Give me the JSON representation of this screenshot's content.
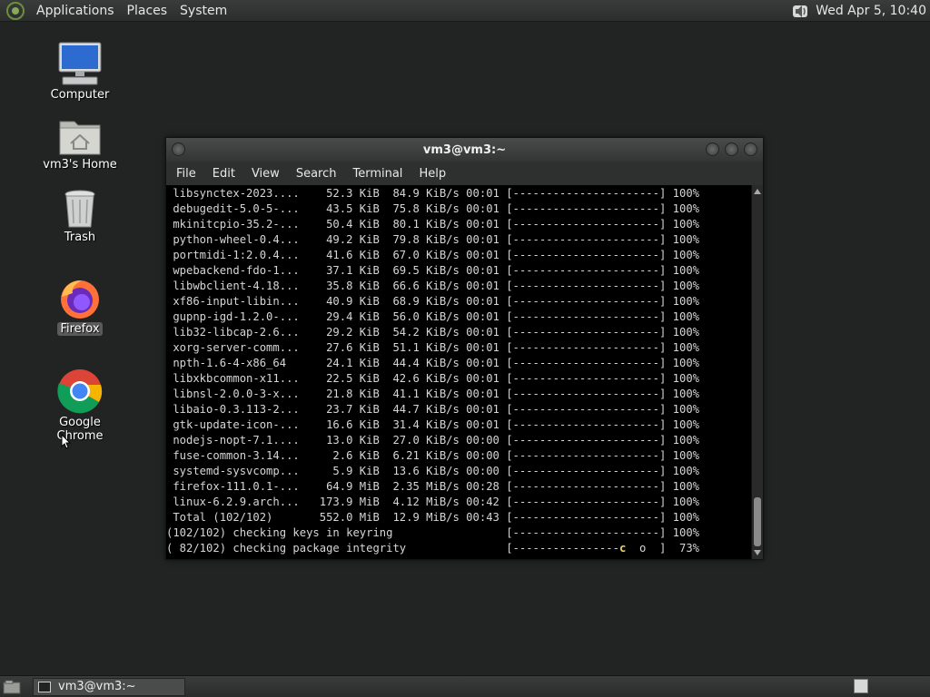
{
  "top_panel": {
    "menus": [
      "Applications",
      "Places",
      "System"
    ],
    "clock": "Wed Apr  5, 10:40"
  },
  "desktop_icons": [
    {
      "label": "Computer",
      "icon": "computer-icon"
    },
    {
      "label": "vm3's Home",
      "icon": "home-folder-icon"
    },
    {
      "label": "Trash",
      "icon": "trash-icon"
    },
    {
      "label": "Firefox",
      "icon": "firefox-icon"
    },
    {
      "label": "Google Chrome",
      "icon": "chrome-icon"
    }
  ],
  "window": {
    "title": "vm3@vm3:~",
    "menu": [
      "File",
      "Edit",
      "View",
      "Search",
      "Terminal",
      "Help"
    ],
    "lines": [
      " libsynctex-2023....    52.3 KiB  84.9 KiB/s 00:01 [----------------------] 100%",
      " debugedit-5.0-5-...    43.5 KiB  75.8 KiB/s 00:01 [----------------------] 100%",
      " mkinitcpio-35.2-...    50.4 KiB  80.1 KiB/s 00:01 [----------------------] 100%",
      " python-wheel-0.4...    49.2 KiB  79.8 KiB/s 00:01 [----------------------] 100%",
      " portmidi-1:2.0.4...    41.6 KiB  67.0 KiB/s 00:01 [----------------------] 100%",
      " wpebackend-fdo-1...    37.1 KiB  69.5 KiB/s 00:01 [----------------------] 100%",
      " libwbclient-4.18...    35.8 KiB  66.6 KiB/s 00:01 [----------------------] 100%",
      " xf86-input-libin...    40.9 KiB  68.9 KiB/s 00:01 [----------------------] 100%",
      " gupnp-igd-1.2.0-...    29.4 KiB  56.0 KiB/s 00:01 [----------------------] 100%",
      " lib32-libcap-2.6...    29.2 KiB  54.2 KiB/s 00:01 [----------------------] 100%",
      " xorg-server-comm...    27.6 KiB  51.1 KiB/s 00:01 [----------------------] 100%",
      " npth-1.6-4-x86_64      24.1 KiB  44.4 KiB/s 00:01 [----------------------] 100%",
      " libxkbcommon-x11...    22.5 KiB  42.6 KiB/s 00:01 [----------------------] 100%",
      " libnsl-2.0.0-3-x...    21.8 KiB  41.1 KiB/s 00:01 [----------------------] 100%",
      " libaio-0.3.113-2...    23.7 KiB  44.7 KiB/s 00:01 [----------------------] 100%",
      " gtk-update-icon-...    16.6 KiB  31.4 KiB/s 00:01 [----------------------] 100%",
      " nodejs-nopt-7.1....    13.0 KiB  27.0 KiB/s 00:00 [----------------------] 100%",
      " fuse-common-3.14...     2.6 KiB  6.21 KiB/s 00:00 [----------------------] 100%",
      " systemd-sysvcomp...     5.9 KiB  13.6 KiB/s 00:00 [----------------------] 100%",
      " firefox-111.0.1-...    64.9 MiB  2.35 MiB/s 00:28 [----------------------] 100%",
      " linux-6.2.9.arch...   173.9 MiB  4.12 MiB/s 00:42 [----------------------] 100%",
      " Total (102/102)       552.0 MiB  12.9 MiB/s 00:43 [----------------------] 100%",
      "(102/102) checking keys in keyring                 [----------------------] 100%"
    ],
    "last_line_left": "( 82/102) checking package integrity               [----------------",
    "last_line_cursor": "c",
    "last_line_right": "  o  ]  73%"
  },
  "taskbar": {
    "task_label": "vm3@vm3:~"
  }
}
